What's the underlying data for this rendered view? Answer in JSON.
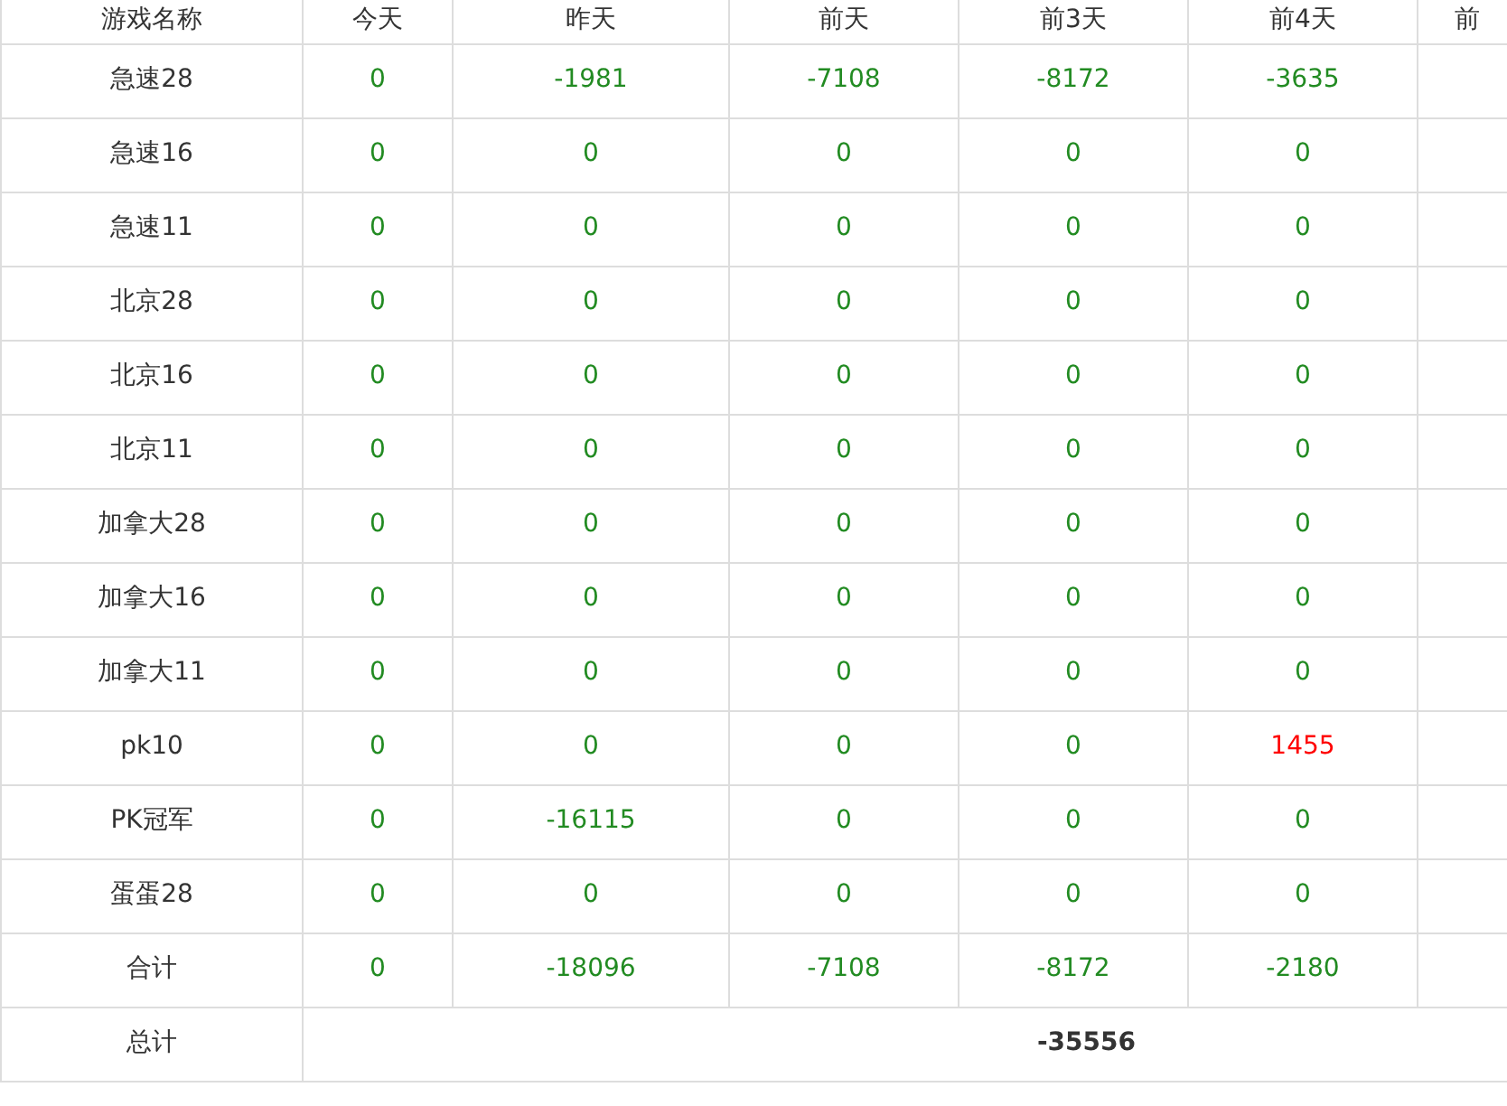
{
  "table": {
    "name_column": "游戏名称",
    "columns": [
      "今天",
      "昨天",
      "前天",
      "前3天",
      "前4天",
      "前"
    ],
    "rows": [
      {
        "name": "急速28",
        "cells": [
          {
            "text": "0",
            "up": false
          },
          {
            "text": "-1981",
            "up": false
          },
          {
            "text": "-7108",
            "up": false
          },
          {
            "text": "-8172",
            "up": false
          },
          {
            "text": "-3635",
            "up": false
          }
        ]
      },
      {
        "name": "急速16",
        "cells": [
          {
            "text": "0",
            "up": false
          },
          {
            "text": "0",
            "up": false
          },
          {
            "text": "0",
            "up": false
          },
          {
            "text": "0",
            "up": false
          },
          {
            "text": "0",
            "up": false
          }
        ]
      },
      {
        "name": "急速11",
        "cells": [
          {
            "text": "0",
            "up": false
          },
          {
            "text": "0",
            "up": false
          },
          {
            "text": "0",
            "up": false
          },
          {
            "text": "0",
            "up": false
          },
          {
            "text": "0",
            "up": false
          }
        ]
      },
      {
        "name": "北京28",
        "cells": [
          {
            "text": "0",
            "up": false
          },
          {
            "text": "0",
            "up": false
          },
          {
            "text": "0",
            "up": false
          },
          {
            "text": "0",
            "up": false
          },
          {
            "text": "0",
            "up": false
          }
        ]
      },
      {
        "name": "北京16",
        "cells": [
          {
            "text": "0",
            "up": false
          },
          {
            "text": "0",
            "up": false
          },
          {
            "text": "0",
            "up": false
          },
          {
            "text": "0",
            "up": false
          },
          {
            "text": "0",
            "up": false
          }
        ]
      },
      {
        "name": "北京11",
        "cells": [
          {
            "text": "0",
            "up": false
          },
          {
            "text": "0",
            "up": false
          },
          {
            "text": "0",
            "up": false
          },
          {
            "text": "0",
            "up": false
          },
          {
            "text": "0",
            "up": false
          }
        ]
      },
      {
        "name": "加拿大28",
        "cells": [
          {
            "text": "0",
            "up": false
          },
          {
            "text": "0",
            "up": false
          },
          {
            "text": "0",
            "up": false
          },
          {
            "text": "0",
            "up": false
          },
          {
            "text": "0",
            "up": false
          }
        ]
      },
      {
        "name": "加拿大16",
        "cells": [
          {
            "text": "0",
            "up": false
          },
          {
            "text": "0",
            "up": false
          },
          {
            "text": "0",
            "up": false
          },
          {
            "text": "0",
            "up": false
          },
          {
            "text": "0",
            "up": false
          }
        ]
      },
      {
        "name": "加拿大11",
        "cells": [
          {
            "text": "0",
            "up": false
          },
          {
            "text": "0",
            "up": false
          },
          {
            "text": "0",
            "up": false
          },
          {
            "text": "0",
            "up": false
          },
          {
            "text": "0",
            "up": false
          }
        ]
      },
      {
        "name": "pk10",
        "cells": [
          {
            "text": "0",
            "up": false
          },
          {
            "text": "0",
            "up": false
          },
          {
            "text": "0",
            "up": false
          },
          {
            "text": "0",
            "up": false
          },
          {
            "text": "1455",
            "up": true
          }
        ]
      },
      {
        "name": "PK冠军",
        "cells": [
          {
            "text": "0",
            "up": false
          },
          {
            "text": "-16115",
            "up": false
          },
          {
            "text": "0",
            "up": false
          },
          {
            "text": "0",
            "up": false
          },
          {
            "text": "0",
            "up": false
          }
        ]
      },
      {
        "name": "蛋蛋28",
        "cells": [
          {
            "text": "0",
            "up": false
          },
          {
            "text": "0",
            "up": false
          },
          {
            "text": "0",
            "up": false
          },
          {
            "text": "0",
            "up": false
          },
          {
            "text": "0",
            "up": false
          }
        ]
      },
      {
        "name": "合计",
        "cells": [
          {
            "text": "0",
            "up": false
          },
          {
            "text": "-18096",
            "up": false
          },
          {
            "text": "-7108",
            "up": false
          },
          {
            "text": "-8172",
            "up": false
          },
          {
            "text": "-2180",
            "up": false
          }
        ]
      }
    ],
    "grand_total": {
      "label": "总计",
      "value": "-35556"
    }
  }
}
